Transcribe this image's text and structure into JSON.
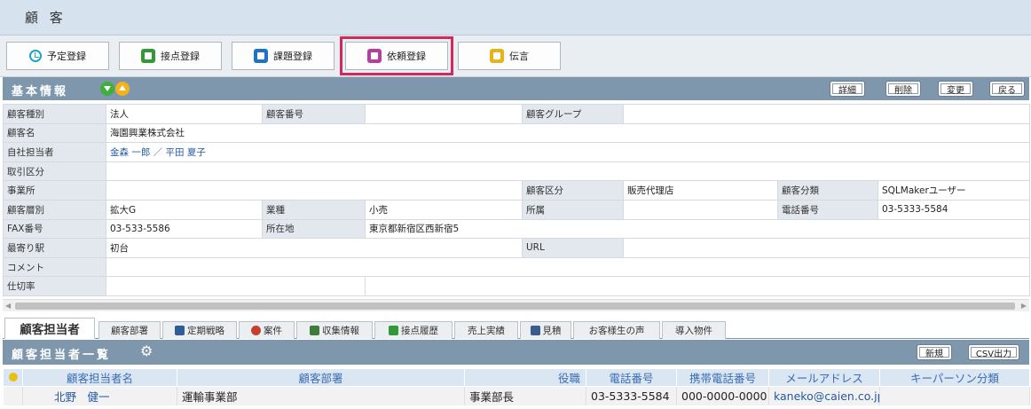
{
  "header": {
    "title": "顧 客"
  },
  "toolbar": {
    "buttons": [
      {
        "label": "予定登録"
      },
      {
        "label": "接点登録"
      },
      {
        "label": "課題登録"
      },
      {
        "label": "依頼登録"
      },
      {
        "label": "伝言"
      }
    ]
  },
  "basic": {
    "title": "基本情報",
    "buttons": {
      "detail": "詳細",
      "delete": "削除",
      "change": "変更",
      "back": "戻る"
    },
    "rows": [
      {
        "l1": "顧客種別",
        "v1": "法人",
        "l2": "顧客番号",
        "v2": "",
        "l3": "顧客グループ",
        "v3": ""
      },
      {
        "l1": "顧客名",
        "v1": "海園興業株式会社"
      },
      {
        "l1": "自社担当者",
        "v1": "金森 一郎 ／ 平田 夏子"
      },
      {
        "l1": "取引区分",
        "v1": ""
      },
      {
        "l1": "事業所",
        "v1": "",
        "l3": "顧客区分",
        "v3": "販売代理店",
        "l4": "顧客分類",
        "v4": "SQLMakerユーザー"
      },
      {
        "l1": "顧客層別",
        "v1": "拡大G",
        "l2": "業種",
        "v2": "小売",
        "l3": "所属",
        "v3": "",
        "l4": "電話番号",
        "v4": "03-5333-5584"
      },
      {
        "l1": "FAX番号",
        "v1": "03-533-5586",
        "l2": "所在地",
        "v2": "東京都新宿区西新宿5"
      },
      {
        "l1": "最寄り駅",
        "v1": "初台",
        "l3": "URL",
        "v3": ""
      },
      {
        "l1": "コメント",
        "v1": ""
      },
      {
        "l1": "仕切率",
        "v1": "",
        "v2": ""
      }
    ]
  },
  "tabs": [
    {
      "label": "顧客担当者"
    },
    {
      "label": "顧客部署"
    },
    {
      "label": "定期戦略"
    },
    {
      "label": "案件"
    },
    {
      "label": "収集情報"
    },
    {
      "label": "接点履歴"
    },
    {
      "label": "売上実績"
    },
    {
      "label": "見積"
    },
    {
      "label": "お客様生の声"
    },
    {
      "label": "導入物件"
    }
  ],
  "contacts": {
    "title": "顧客担当者一覧",
    "buttons": {
      "new": "新規",
      "csv": "CSV出力"
    },
    "columns": [
      "顧客担当者名",
      "顧客部署",
      "役職",
      "電話番号",
      "携帯電話番号",
      "メールアドレス",
      "キーパーソン分類"
    ],
    "rows": [
      {
        "name": "北野　健一",
        "dept": "運輸事業部",
        "title": "事業部長",
        "tel": "03-5333-5584",
        "mobile": "000-0000-0000",
        "email": "kaneko@caien.co.jp",
        "key": ""
      }
    ]
  }
}
